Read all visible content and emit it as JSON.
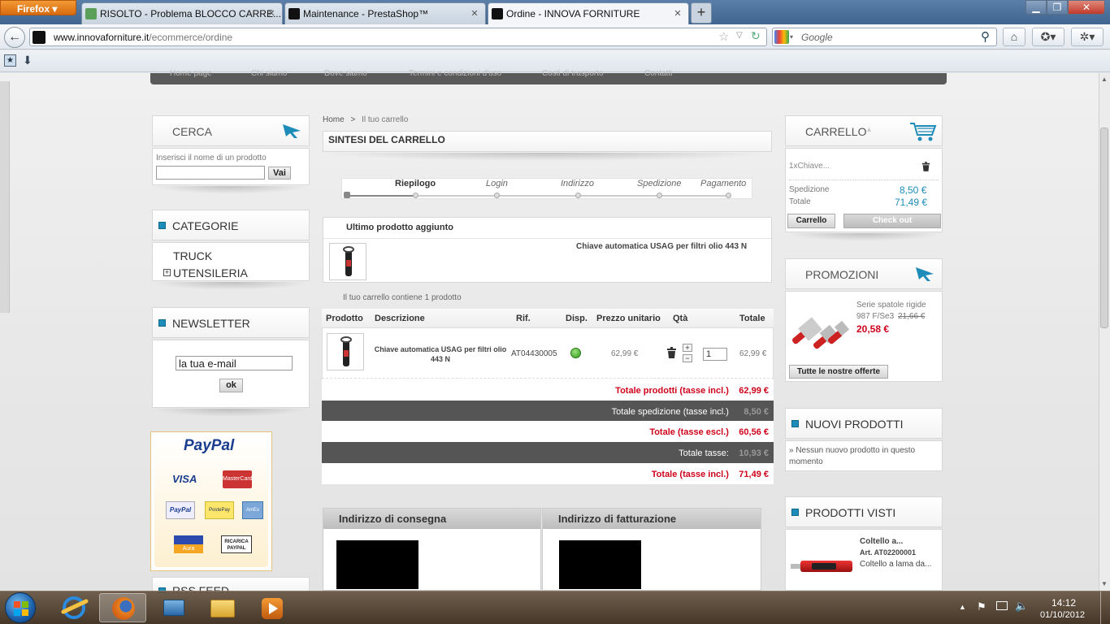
{
  "browser": {
    "menu_label": "Firefox",
    "tabs": [
      {
        "title": "RISOLTO - Problema BLOCCO CARRE...",
        "icon_color": "#5aa05a"
      },
      {
        "title": "Maintenance - PrestaShop™",
        "icon_color": "#111111"
      },
      {
        "title": "Ordine - INNOVA FORNITURE",
        "icon_color": "#111111"
      }
    ],
    "new_tab_label": "+",
    "window_buttons": {
      "minimize": "▁",
      "restore": "❐",
      "close": "✕"
    },
    "url_host": "www.innovaforniture.it",
    "url_path": "/ecommerce/ordine",
    "search_placeholder": "Google",
    "icons": {
      "back": "back-arrow-icon",
      "star": "bookmark-star-icon",
      "reload": "reload-icon",
      "home": "home-icon",
      "search": "magnifier-icon"
    }
  },
  "nav_menu_partial": [
    "Home page",
    "Chi siamo",
    "Dove siamo",
    "Termini e condizioni d'uso",
    "Costi di trasporto",
    "Contatti"
  ],
  "left": {
    "search": {
      "title": "Cerca",
      "label": "Inserisci il nome di un prodotto",
      "button": "Vai"
    },
    "categories": {
      "title": "Categorie",
      "items": [
        "TRUCK",
        "UTENSILERIA"
      ],
      "expand": "+"
    },
    "newsletter": {
      "title": "Newsletter",
      "input_value": "la tua e-mail",
      "button": "ok"
    },
    "paypal": {
      "logo": "PayPal",
      "cards": [
        "VISA",
        "MasterCard",
        "PayPal",
        "PostePay",
        "AmEx",
        "Aura",
        "RICARICA PAYPAL"
      ]
    },
    "rss_title": "RSS feed"
  },
  "center": {
    "breadcrumb": {
      "home": "Home",
      "sep": ">",
      "current": "Il tuo carrello"
    },
    "heading": "Sintesi del carrello",
    "steps": [
      "Riepilogo",
      "Login",
      "Indirizzo",
      "Spedizione",
      "Pagamento"
    ],
    "last_added": {
      "title": "Ultimo prodotto aggiunto",
      "name": "Chiave automatica USAG per filtri olio 443 N"
    },
    "summary_count": "Il tuo carrello contiene 1 prodotto",
    "table": {
      "headers": [
        "Prodotto",
        "Descrizione",
        "Rif.",
        "Disp.",
        "Prezzo unitario",
        "Qtà",
        "Totale"
      ],
      "row": {
        "desc": "Chiave automatica USAG per filtri olio 443 N",
        "ref": "AT04430005",
        "price": "62,99 €",
        "qty": "1",
        "plus": "+",
        "minus": "−",
        "total": "62,99 €"
      }
    },
    "totals": [
      {
        "label": "Totale prodotti (tasse incl.)",
        "value": "62,99 €",
        "style": "light"
      },
      {
        "label": "Totale spedizione (tasse incl.)",
        "value": "8,50 €",
        "style": "dark"
      },
      {
        "label": "Totale (tasse escl.)",
        "value": "60,56 €",
        "style": "light"
      },
      {
        "label": "Totale tasse:",
        "value": "10,93 €",
        "style": "dark"
      },
      {
        "label": "Totale (tasse incl.)",
        "value": "71,49 €",
        "style": "light"
      }
    ],
    "addresses": {
      "delivery": "Indirizzo di consegna",
      "billing": "Indirizzo di fatturazione"
    }
  },
  "right": {
    "cart": {
      "title": "Carrello",
      "item": "1xChiave...",
      "shipping_label": "Spedizione",
      "shipping_value": "8,50 €",
      "total_label": "Totale",
      "total_value": "71,49 €",
      "cart_btn": "Carrello",
      "checkout_btn": "Check out"
    },
    "promo": {
      "title": "Promozioni",
      "name": "Serie spatole rigide",
      "ref": "987 F/Se3",
      "old_price": "21,66 €",
      "new_price": "20,58 €",
      "button": "Tutte le nostre offerte"
    },
    "new_products": {
      "title": "Nuovi prodotti",
      "text": "» Nessun nuovo prodotto in questo momento"
    },
    "viewed": {
      "title": "Prodotti visti",
      "name": "Coltello a...",
      "ref": "Art. AT02200001",
      "desc": "Coltello a lama da..."
    }
  },
  "taskbar": {
    "time": "14:12",
    "date": "01/10/2012",
    "apps": [
      "internet-explorer-icon",
      "firefox-icon",
      "network-icon",
      "explorer-folder-icon",
      "media-player-icon"
    ]
  },
  "colors": {
    "accent": "#1d8cb8",
    "price_red": "#d0021b",
    "dark_row": "#555555",
    "firefox_orange": "#e8801f"
  }
}
